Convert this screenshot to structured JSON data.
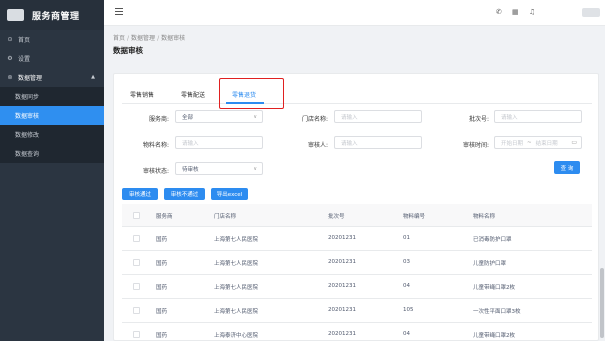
{
  "app": {
    "title": "服务商管理"
  },
  "sidebar": {
    "items": [
      {
        "label": "首页",
        "icon": "home-icon"
      },
      {
        "label": "设置",
        "icon": "gear-icon"
      },
      {
        "label": "数据管理",
        "icon": "data-icon"
      }
    ],
    "sub_items": [
      {
        "label": "数据同步"
      },
      {
        "label": "数据审核",
        "active": true
      },
      {
        "label": "数据修改"
      },
      {
        "label": "数据查询"
      }
    ]
  },
  "breadcrumb": {
    "items": [
      "首页",
      "数据管理",
      "数据审核"
    ]
  },
  "page": {
    "title": "数据审核"
  },
  "tabs": [
    {
      "label": "零售销售"
    },
    {
      "label": "零售配送"
    },
    {
      "label": "零售退货",
      "active": true
    }
  ],
  "filters": {
    "service_provider": {
      "label": "服务商:",
      "value": "全部"
    },
    "store_name": {
      "label": "门店名称:",
      "placeholder": "请输入"
    },
    "batch_no": {
      "label": "批次号:",
      "placeholder": "请输入"
    },
    "material_name": {
      "label": "物料名称:",
      "placeholder": "请输入"
    },
    "reviewer": {
      "label": "审核人:",
      "placeholder": "请输入"
    },
    "review_time": {
      "label": "审核时间:",
      "start": "开始日期",
      "end": "结束日期",
      "separator": "~"
    },
    "review_status": {
      "label": "审核状态:",
      "value": "待审核"
    }
  },
  "buttons": {
    "query": "查 询",
    "approve": "审核通过",
    "reject": "审核不通过",
    "export": "导出excel"
  },
  "table": {
    "columns": [
      "服务商",
      "门店名称",
      "批次号",
      "物料编号",
      "物料名称"
    ],
    "rows": [
      [
        "国药",
        "上海第七人民医院",
        "20201231",
        "01",
        "已消毒防护口罩"
      ],
      [
        "国药",
        "上海第七人民医院",
        "20201231",
        "03",
        "儿童防护口罩"
      ],
      [
        "国药",
        "上海第七人民医院",
        "20201231",
        "04",
        "儿童带绳口罩2枚"
      ],
      [
        "国药",
        "上海第七人民医院",
        "20201231",
        "105",
        "一次性平面口罩3枚"
      ],
      [
        "国药",
        "上海泰济中心医院",
        "20201231",
        "04",
        "儿童带绳口罩2枚"
      ]
    ]
  }
}
